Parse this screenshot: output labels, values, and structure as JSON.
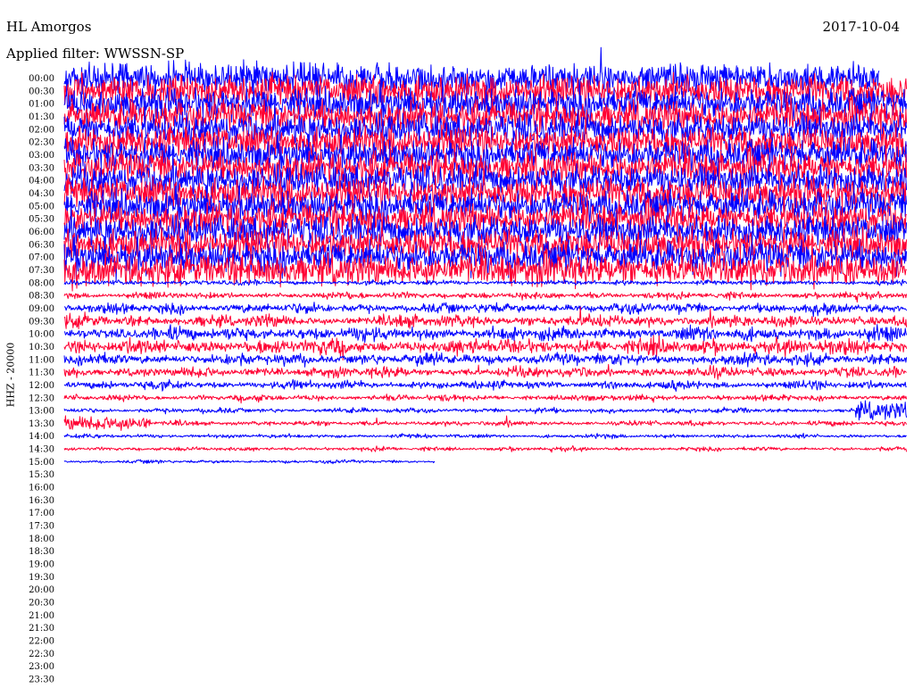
{
  "header": {
    "station": "HL Amorgos",
    "date": "2017-10-04",
    "filter_label": "Applied filter: WWSSN-SP"
  },
  "channel_label": "HHZ - 20000",
  "chart_data": {
    "type": "line",
    "title": "HL Amorgos",
    "subtitle": "Applied filter: WWSSN-SP",
    "date": "2017-10-04",
    "ylabel": "HHZ - 20000",
    "row_labels": [
      "00:00",
      "00:30",
      "01:00",
      "01:30",
      "02:00",
      "02:30",
      "03:00",
      "03:30",
      "04:00",
      "04:30",
      "05:00",
      "05:30",
      "06:00",
      "06:30",
      "07:00",
      "07:30",
      "08:00",
      "08:30",
      "09:00",
      "09:30",
      "10:00",
      "10:30",
      "11:00",
      "11:30",
      "12:00",
      "12:30",
      "13:00",
      "13:30",
      "14:00",
      "14:30",
      "15:00",
      "15:30",
      "16:00",
      "16:30",
      "17:00",
      "17:30",
      "18:00",
      "18:30",
      "19:00",
      "19:30",
      "20:00",
      "20:30",
      "21:00",
      "21:30",
      "22:00",
      "22:30",
      "23:00",
      "23:30"
    ],
    "trace_colors": [
      "#0000ff",
      "#ff0033"
    ],
    "rows_with_data": 31,
    "last_row_completeness": 0.44,
    "relative_amplitude": [
      1.0,
      1.0,
      1.0,
      1.0,
      1.0,
      1.0,
      1.0,
      1.0,
      1.0,
      1.0,
      1.0,
      1.0,
      1.0,
      1.0,
      1.0,
      1.0,
      0.15,
      0.2,
      0.3,
      0.35,
      0.4,
      0.45,
      0.35,
      0.3,
      0.25,
      0.18,
      0.15,
      0.15,
      0.12,
      0.12,
      0.1
    ],
    "events": [
      {
        "row": "13:00",
        "position": "end",
        "note": "burst"
      },
      {
        "row": "13:30",
        "position": "start",
        "note": "burst"
      }
    ],
    "grid": false
  }
}
